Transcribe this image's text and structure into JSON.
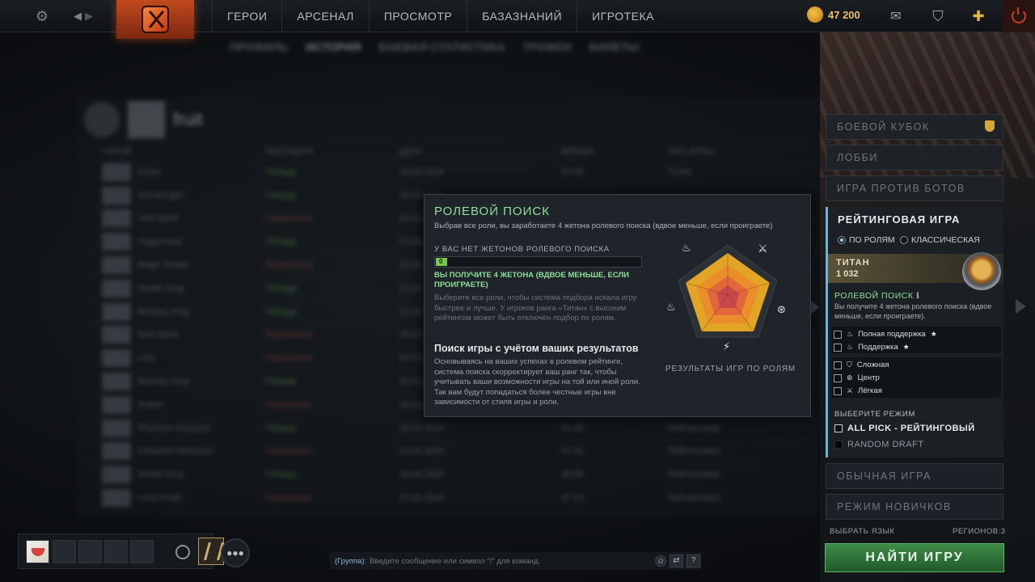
{
  "topbar": {
    "nav": [
      "ГЕРОИ",
      "АРСЕНАЛ",
      "ПРОСМОТР",
      "БАЗАЗНАНИЙ",
      "ИГРОТЕКА"
    ],
    "currency_amount": "47 200",
    "icons": [
      "gear-icon",
      "back-arrow-icon",
      "forward-arrow-icon",
      "dota-logo",
      "currency-coin-icon",
      "chat-icon",
      "armory-icon",
      "plus-icon",
      "power-icon"
    ]
  },
  "background_profile": {
    "tabs": [
      "ПРОФИЛЬ",
      "ИСТОРИЯ",
      "БОЕВАЯ СТАТИСТИКА",
      "ТРОФЕИ",
      "БИЛЕТЫ"
    ],
    "player_name": "fruit",
    "columns": [
      "ГЕРОЙ",
      "РЕЗУЛЬТАТ",
      "ДАТА",
      "ВРЕМЯ",
      "ТИП ИГРЫ"
    ],
    "rows": [
      {
        "hero": "Clinkz",
        "result": "Победа",
        "date": "15.02.2024",
        "time": "37:09",
        "type": "Turbo"
      },
      {
        "hero": "Omniknight",
        "result": "Победа",
        "date": "15.02.2024",
        "time": "",
        "type": ""
      },
      {
        "hero": "Void Spirit",
        "result": "Поражение",
        "date": "15.02.2024",
        "time": "",
        "type": ""
      },
      {
        "hero": "Juggernaut",
        "result": "Победа",
        "date": "15.02.2024",
        "time": "",
        "type": ""
      },
      {
        "hero": "Magic Ember",
        "result": "Поражение",
        "date": "15.02.2024",
        "time": "",
        "type": ""
      },
      {
        "hero": "Wraith King",
        "result": "Победа",
        "date": "15.02.2024",
        "time": "",
        "type": ""
      },
      {
        "hero": "Monkey King",
        "result": "Победа",
        "date": "15.02.2024",
        "time": "",
        "type": ""
      },
      {
        "hero": "Void Spirit",
        "result": "Поражение",
        "date": "15.02.2024",
        "time": "",
        "type": ""
      },
      {
        "hero": "Lina",
        "result": "Поражение",
        "date": "15.02.2024",
        "time": "",
        "type": ""
      },
      {
        "hero": "Monkey King",
        "result": "Победа",
        "date": "15.02.2024",
        "time": "",
        "type": ""
      },
      {
        "hero": "Sniper",
        "result": "Поражение",
        "date": "15.02.2024",
        "time": "",
        "type": ""
      },
      {
        "hero": "Phantom Assassin",
        "result": "Победа",
        "date": "15.02.2024",
        "time": "41:45",
        "type": "Рейтинговая"
      },
      {
        "hero": "Outworld Destroyer",
        "result": "Поражение",
        "date": "15.02.2024",
        "time": "47:31",
        "type": "Рейтинговая"
      },
      {
        "hero": "Wraith King",
        "result": "Победа",
        "date": "15.02.2024",
        "time": "40:59",
        "type": "Рейтинговая"
      },
      {
        "hero": "Lone Druid",
        "result": "Поражение",
        "date": "15.02.2024",
        "time": "47:23",
        "type": "Рейтинговая"
      }
    ]
  },
  "popup": {
    "title": "РОЛЕВОЙ ПОИСК",
    "subtitle": "Выбрав все роли, вы заработаете 4 жетона ролевого поиска (вдвое меньше, если проиграете)",
    "tokens_label": "У ВАС НЕТ ЖЕТОНОВ РОЛЕВОГО ПОИСКА",
    "tokens_bar_value": 0,
    "tokens_bar_text": "0",
    "gain_text": "ВЫ ПОЛУЧИТЕ 4 ЖЕТОНА (ВДВОЕ МЕНЬШЕ, ЕСЛИ ПРОИГРАЕТЕ)",
    "info_text": "Выберите все роли, чтобы система подбора искала игру быстрее и лучше. У игроков ранга «Титан» с высоким рейтингом может быть отключён подбор по ролям.",
    "heading2": "Поиск игры с учётом ваших результатов",
    "body2": "Основываясь на ваших успехах в ролевом рейтинге, система поиска скорректирует ваш ранг так, чтобы учитывать ваши возможности игры на той или иной роли. Так вам будут попадаться более честные игры вне зависимости от стиля игры и роли.",
    "radar_caption": "РЕЗУЛЬТАТЫ ИГР ПО РОЛЯМ",
    "radar_icons": [
      "hard-support-icon",
      "carry-icon",
      "offlane-icon",
      "mid-icon",
      "soft-support-icon"
    ]
  },
  "right_panel": {
    "buttons": [
      "БОЕВОЙ КУБОК",
      "ЛОББИ",
      "ИГРА ПРОТИВ БОТОВ"
    ],
    "ranked": {
      "title": "РЕЙТИНГОВАЯ ИГРА",
      "radio_roles": "ПО РОЛЯМ",
      "radio_classic": "КЛАССИЧЕСКАЯ",
      "rank_name": "ТИТАН",
      "rank_mmr": "1 032",
      "role_search_label": "РОЛЕВОЙ ПОИСК",
      "role_search_desc": "Вы получите 4 жетона ролевого поиска (вдвое меньше, если проиграете).",
      "roles": [
        "Полная поддержка",
        "Поддержка",
        "Сложная",
        "Центр",
        "Лёгкая"
      ],
      "mode_heading": "ВЫБЕРИТЕ РЕЖИМ",
      "modes": [
        "ALL PICK - РЕЙТИНГОВЫЙ",
        "RANDOM DRAFT"
      ]
    },
    "bottom_buttons": [
      "ОБЫЧНАЯ ИГРА",
      "РЕЖИМ НОВИЧКОВ"
    ],
    "language_label": "ВЫБРАТЬ ЯЗЫК",
    "regions_label": "РЕГИОНОВ:3",
    "find_button": "НАЙТИ ИГРУ"
  },
  "bottom": {
    "chat_channel": "(Группа):",
    "chat_placeholder": "Введите сообщение или символ \"/\" для команд.",
    "chat_help": "?"
  }
}
